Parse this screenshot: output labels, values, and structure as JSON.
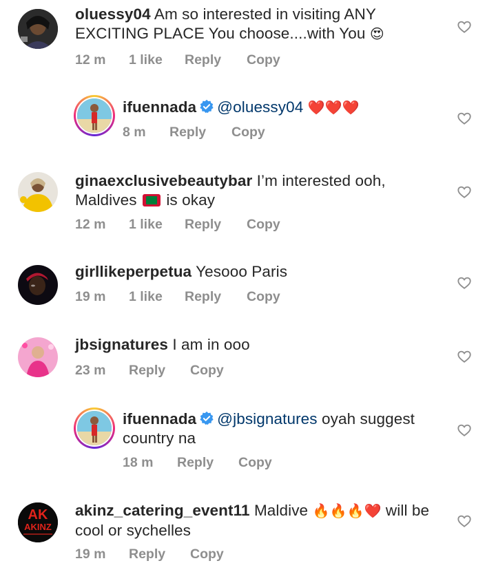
{
  "comments": [
    {
      "username": "oluessy04",
      "text_line1": " Am so interested in visiting ANY",
      "text_line2": "EXCITING PLACE You choose....with You",
      "emoji": "😍",
      "time": "12 m",
      "likes": "1 like",
      "reply": "Reply",
      "copy": "Copy"
    },
    {
      "username": "ifuennada",
      "mention": "@oluessy04",
      "emoji": "❤️❤️❤️",
      "time": "8 m",
      "reply": "Reply",
      "copy": "Copy"
    },
    {
      "username": "ginaexclusivebeautybar",
      "text_line1": " I’m interested ooh,",
      "text_line2a": "Maldives",
      "text_line2b": "is okay",
      "time": "12 m",
      "likes": "1 like",
      "reply": "Reply",
      "copy": "Copy"
    },
    {
      "username": "girllikeperpetua",
      "text_line1": " Yesooo Paris",
      "time": "19 m",
      "likes": "1 like",
      "reply": "Reply",
      "copy": "Copy"
    },
    {
      "username": "jbsignatures",
      "text_line1": " I am in ooo",
      "time": "23 m",
      "reply": "Reply",
      "copy": "Copy"
    },
    {
      "username": "ifuennada",
      "mention": "@jbsignatures",
      "text_line1": " oyah suggest",
      "text_line2": "country na",
      "time": "18 m",
      "reply": "Reply",
      "copy": "Copy"
    },
    {
      "username": "akinz_catering_event11",
      "text_line1": " Maldive",
      "emoji": "🔥🔥🔥❤️",
      "text_line1b": " will be",
      "text_line2": "cool or sychelles",
      "time": "19 m",
      "reply": "Reply",
      "copy": "Copy",
      "avatar_text": "AKINZ"
    }
  ],
  "colors": {
    "text": "#262626",
    "meta": "#8e8e8e",
    "mention": "#00376b",
    "verified": "#3897f0"
  }
}
